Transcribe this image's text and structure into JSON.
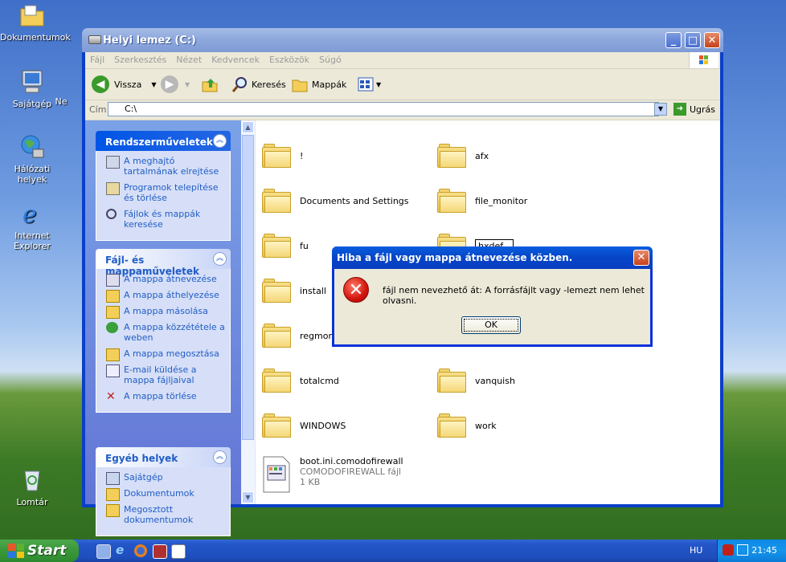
{
  "desktop": {
    "icons": [
      {
        "label": "Dokumentumok"
      },
      {
        "label": "Sajátgép"
      },
      {
        "label": "Ne"
      },
      {
        "label": "Hálózati helyek"
      },
      {
        "label": "Internet Explorer"
      },
      {
        "label": "Lomtár"
      }
    ]
  },
  "window": {
    "title": "Helyi lemez (C:)",
    "menu": [
      "Fájl",
      "Szerkesztés",
      "Nézet",
      "Kedvencek",
      "Eszközök",
      "Súgó"
    ],
    "toolbar": {
      "back": "Vissza",
      "search": "Keresés",
      "folders": "Mappák"
    },
    "address": {
      "label": "Cím",
      "value": "C:\\",
      "go": "Ugrás"
    }
  },
  "tasks": {
    "system": {
      "title": "Rendszerműveletek",
      "items": [
        "A meghajtó tartalmának elrejtése",
        "Programok telepítése és törlése",
        "Fájlok és mappák keresése"
      ]
    },
    "file": {
      "title": "Fájl- és mappaműveletek",
      "items": [
        "A mappa átnevezése",
        "A mappa áthelyezése",
        "A mappa másolása",
        "A mappa közzététele a weben",
        "A mappa megosztása",
        "E-mail küldése a mappa fájljaival",
        "A mappa törlése"
      ]
    },
    "other": {
      "title": "Egyéb helyek",
      "items": [
        "Sajátgép",
        "Dokumentumok",
        "Megosztott dokumentumok"
      ]
    }
  },
  "files": {
    "folders": [
      "!",
      "afx",
      "Documents and Settings",
      "file_monitor",
      "fu",
      "hxdef",
      "install",
      "regmoni",
      "totalcmd",
      "vanquish",
      "WINDOWS",
      "work"
    ],
    "file": {
      "name": "boot.ini.comodofirewall",
      "type": "COMODOFIREWALL fájl",
      "size": "1 KB"
    }
  },
  "dialog": {
    "title": "Hiba a fájl vagy mappa átnevezése közben.",
    "message": "fájl nem nevezhető át: A forrásfájlt vagy -lemezt nem lehet olvasni.",
    "ok": "OK",
    "icon": "error-icon"
  },
  "taskbar": {
    "start": "Start",
    "lang": "HU",
    "clock": "21:45"
  },
  "colors": {
    "xp_blue": "#0a3fc8",
    "start_green": "#3c9a3c",
    "task_link": "#215dc6"
  }
}
